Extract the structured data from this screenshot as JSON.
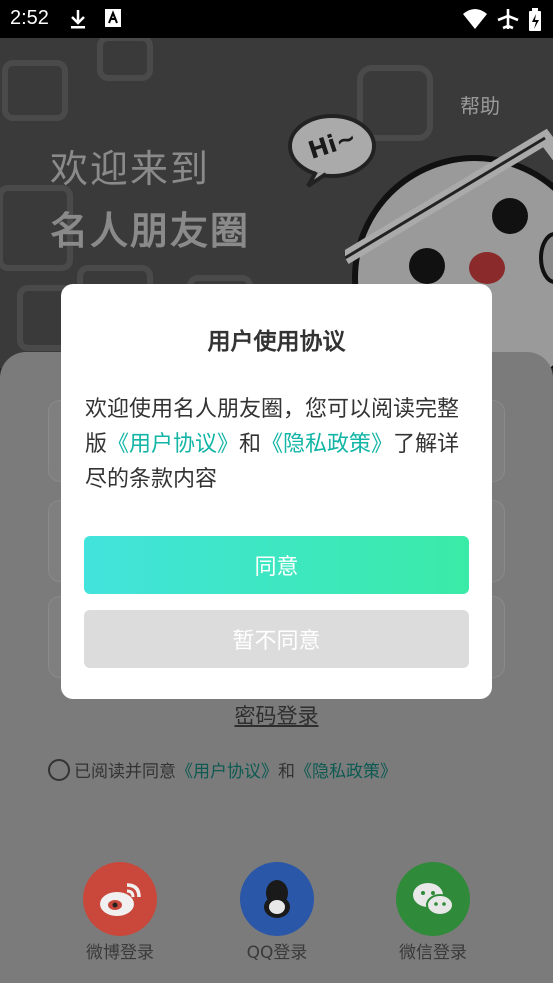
{
  "status_bar": {
    "time": "2:52"
  },
  "header": {
    "help_label": "帮助",
    "welcome_line1": "欢迎来到",
    "welcome_line2": "名人朋友圈",
    "bubble_text": "Hi~"
  },
  "login": {
    "password_login": "密码登录",
    "agree_prefix": "已阅读并同意",
    "user_agreement": "《用户协议》",
    "and": "和",
    "privacy_policy": "《隐私政策》",
    "social": [
      {
        "label": "微博登录",
        "color": "#c9473b",
        "icon": "weibo-icon"
      },
      {
        "label": "QQ登录",
        "color": "#2a57a8",
        "icon": "qq-icon"
      },
      {
        "label": "微信登录",
        "color": "#2f8a3a",
        "icon": "wechat-icon"
      }
    ]
  },
  "dialog": {
    "title": "用户使用协议",
    "body_prefix": "欢迎使用名人朋友圈，您可以阅读完整版",
    "user_agreement": "《用户协议》",
    "and": "和",
    "privacy_policy": "《隐私政策》",
    "body_suffix": "了解详尽的条款内容",
    "agree_button": "同意",
    "decline_button": "暂不同意"
  },
  "colors": {
    "accent": "#12b5a6",
    "agree_start": "#42e3dc",
    "agree_end": "#3aeba7"
  }
}
